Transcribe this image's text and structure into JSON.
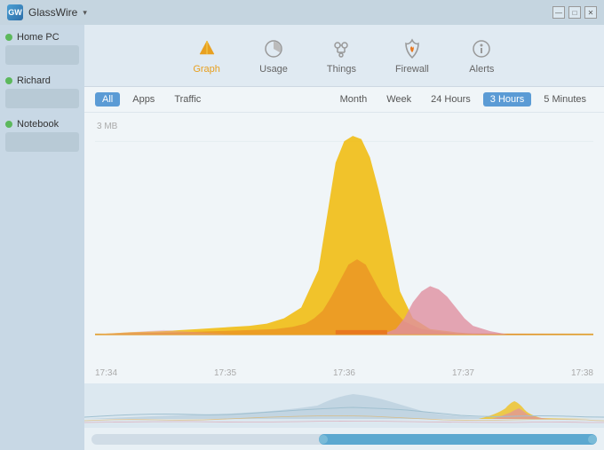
{
  "titleBar": {
    "appName": "GlassWire",
    "dropdownIcon": "▾",
    "minimize": "—",
    "maximize": "□",
    "close": "✕"
  },
  "sidebar": {
    "items": [
      {
        "label": "Home PC",
        "status": "green"
      },
      {
        "label": "Richard",
        "status": "green"
      },
      {
        "label": "Notebook",
        "status": "green"
      }
    ]
  },
  "nav": {
    "items": [
      {
        "id": "graph",
        "label": "Graph",
        "active": true
      },
      {
        "id": "usage",
        "label": "Usage",
        "active": false
      },
      {
        "id": "things",
        "label": "Things",
        "active": false
      },
      {
        "id": "firewall",
        "label": "Firewall",
        "active": false
      },
      {
        "id": "alerts",
        "label": "Alerts",
        "active": false
      }
    ]
  },
  "filters": {
    "typeButtons": [
      {
        "label": "All",
        "active": true
      },
      {
        "label": "Apps",
        "active": false
      },
      {
        "label": "Traffic",
        "active": false
      }
    ],
    "timeButtons": [
      {
        "label": "Month",
        "active": false
      },
      {
        "label": "Week",
        "active": false
      },
      {
        "label": "24 Hours",
        "active": false
      },
      {
        "label": "3 Hours",
        "active": true
      },
      {
        "label": "5 Minutes",
        "active": false
      }
    ]
  },
  "chart": {
    "yLabel": "3 MB",
    "timeLabels": [
      "17:34",
      "17:35",
      "17:36",
      "17:37",
      "17:38"
    ],
    "colors": {
      "yellow": "#f0c020",
      "orange": "#e87820",
      "pink": "#e090a0",
      "accent": "#5ba8d0"
    }
  }
}
